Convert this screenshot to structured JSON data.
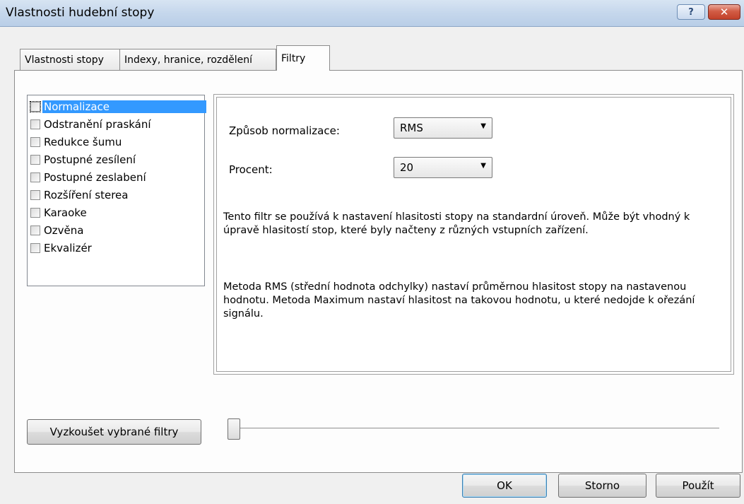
{
  "window": {
    "title": "Vlastnosti hudební stopy",
    "help_glyph": "?",
    "close_glyph": "✕"
  },
  "tabs": [
    {
      "label": "Vlastnosti stopy",
      "active": false
    },
    {
      "label": "Indexy, hranice, rozdělení",
      "active": false
    },
    {
      "label": "Filtry",
      "active": true
    }
  ],
  "filters": [
    {
      "label": "Normalizace",
      "checked": false,
      "selected": true
    },
    {
      "label": "Odstranění praskání",
      "checked": false,
      "selected": false
    },
    {
      "label": "Redukce šumu",
      "checked": false,
      "selected": false
    },
    {
      "label": "Postupné zesílení",
      "checked": false,
      "selected": false
    },
    {
      "label": "Postupné zeslabení",
      "checked": false,
      "selected": false
    },
    {
      "label": "Rozšíření sterea",
      "checked": false,
      "selected": false
    },
    {
      "label": "Karaoke",
      "checked": false,
      "selected": false
    },
    {
      "label": "Ozvěna",
      "checked": false,
      "selected": false
    },
    {
      "label": "Ekvalizér",
      "checked": false,
      "selected": false
    }
  ],
  "options": {
    "method_label": "Způsob normalizace:",
    "method_value": "RMS",
    "percent_label": "Procent:",
    "percent_value": "20",
    "description1": "Tento filtr se používá k nastavení hlasitosti stopy na standardní úroveň. Může být vhodný k úpravě hlasitostí stop, které byly načteny z různých vstupních zařízení.",
    "description2": "Metoda RMS (střední hodnota odchylky) nastaví průměrnou hlasitost stopy na nastavenou hodnotu. Metoda Maximum nastaví hlasitost na takovou hodnotu, u které nedojde k ořezání signálu."
  },
  "test_button": "Vyzkoušet vybrané filtry",
  "slider": {
    "value": 0
  },
  "buttons": {
    "ok": "OK",
    "cancel": "Storno",
    "apply": "Použít"
  },
  "colors": {
    "selection": "#3399ff",
    "titlebar": "#c5d7ec",
    "close": "#c2412a"
  }
}
